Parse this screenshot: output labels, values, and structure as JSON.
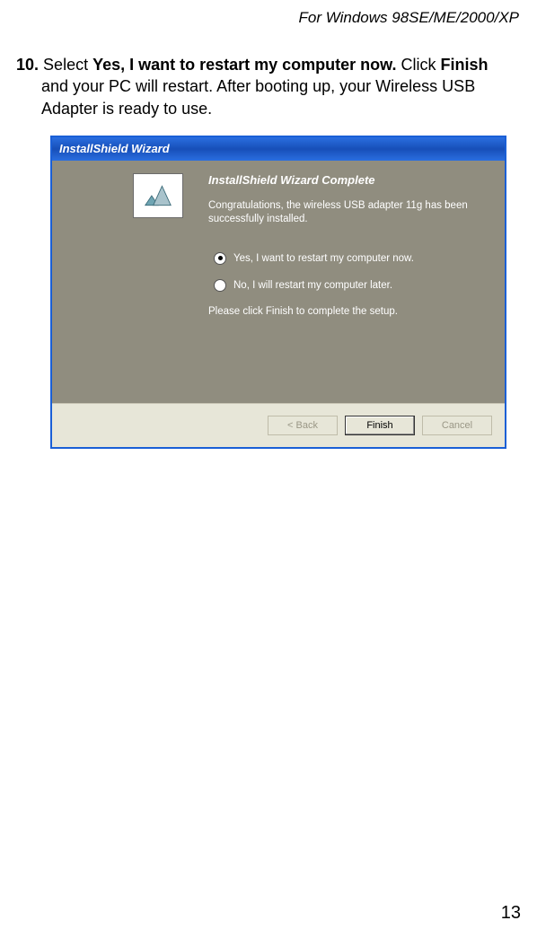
{
  "header": "For Windows 98SE/ME/2000/XP",
  "step": {
    "number": "10.",
    "prefix": "Select ",
    "bold1": "Yes, I want to restart my computer now.",
    "mid": " Click ",
    "bold2": "Finish",
    "rest_line1": "and your PC will restart. After booting up, your Wireless USB",
    "rest_line2": "Adapter is ready to use."
  },
  "dialog": {
    "title": "InstallShield Wizard",
    "heading": "InstallShield Wizard Complete",
    "congrats": "Congratulations, the wireless USB adapter 11g has been successfully installed.",
    "option1": "Yes, I want to restart my computer now.",
    "option2": "No, I will restart my computer later.",
    "finish_text": "Please click Finish to complete the setup.",
    "buttons": {
      "back": "< Back",
      "finish": "Finish",
      "cancel": "Cancel"
    }
  },
  "page_number": "13"
}
